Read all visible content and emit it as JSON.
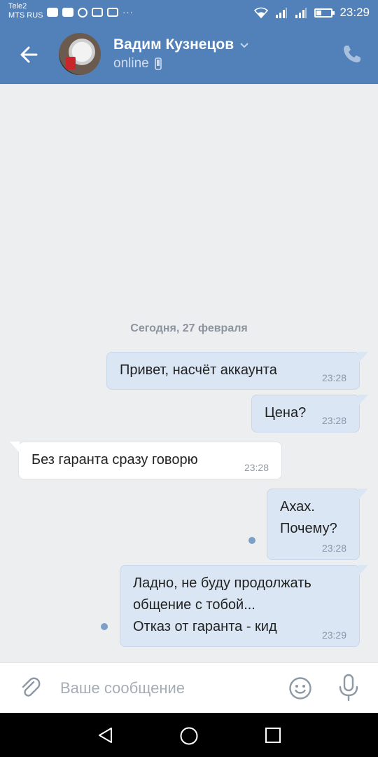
{
  "status_bar": {
    "carrier1": "Tele2",
    "carrier2": "MTS RUS",
    "more": "···",
    "time": "23:29"
  },
  "header": {
    "contact_name": "Вадим Кузнецов",
    "status": "online",
    "accent_color": "#5181b8"
  },
  "chat": {
    "date_separator": "Сегодня, 27 февраля",
    "messages": [
      {
        "direction": "out",
        "text": "Привет, насчёт аккаунта",
        "time": "23:28",
        "read": true
      },
      {
        "direction": "out",
        "text": "Цена?",
        "time": "23:28",
        "read": true
      },
      {
        "direction": "in",
        "text": "Без гаранта сразу говорю",
        "time": "23:28"
      },
      {
        "direction": "out",
        "text": "Ахах.\nПочему?",
        "time": "23:28",
        "read": false
      },
      {
        "direction": "out",
        "text": "Ладно, не буду продолжать\nобщение с тобой...\nОтказ от гаранта - кид",
        "time": "23:29",
        "read": false
      }
    ]
  },
  "composer": {
    "placeholder": "Ваше сообщение",
    "value": ""
  },
  "icons": {
    "back": "arrow-left-icon",
    "call": "phone-icon",
    "attach": "paperclip-icon",
    "emoji": "smile-icon",
    "voice": "microphone-icon",
    "device": "mobile-icon"
  }
}
